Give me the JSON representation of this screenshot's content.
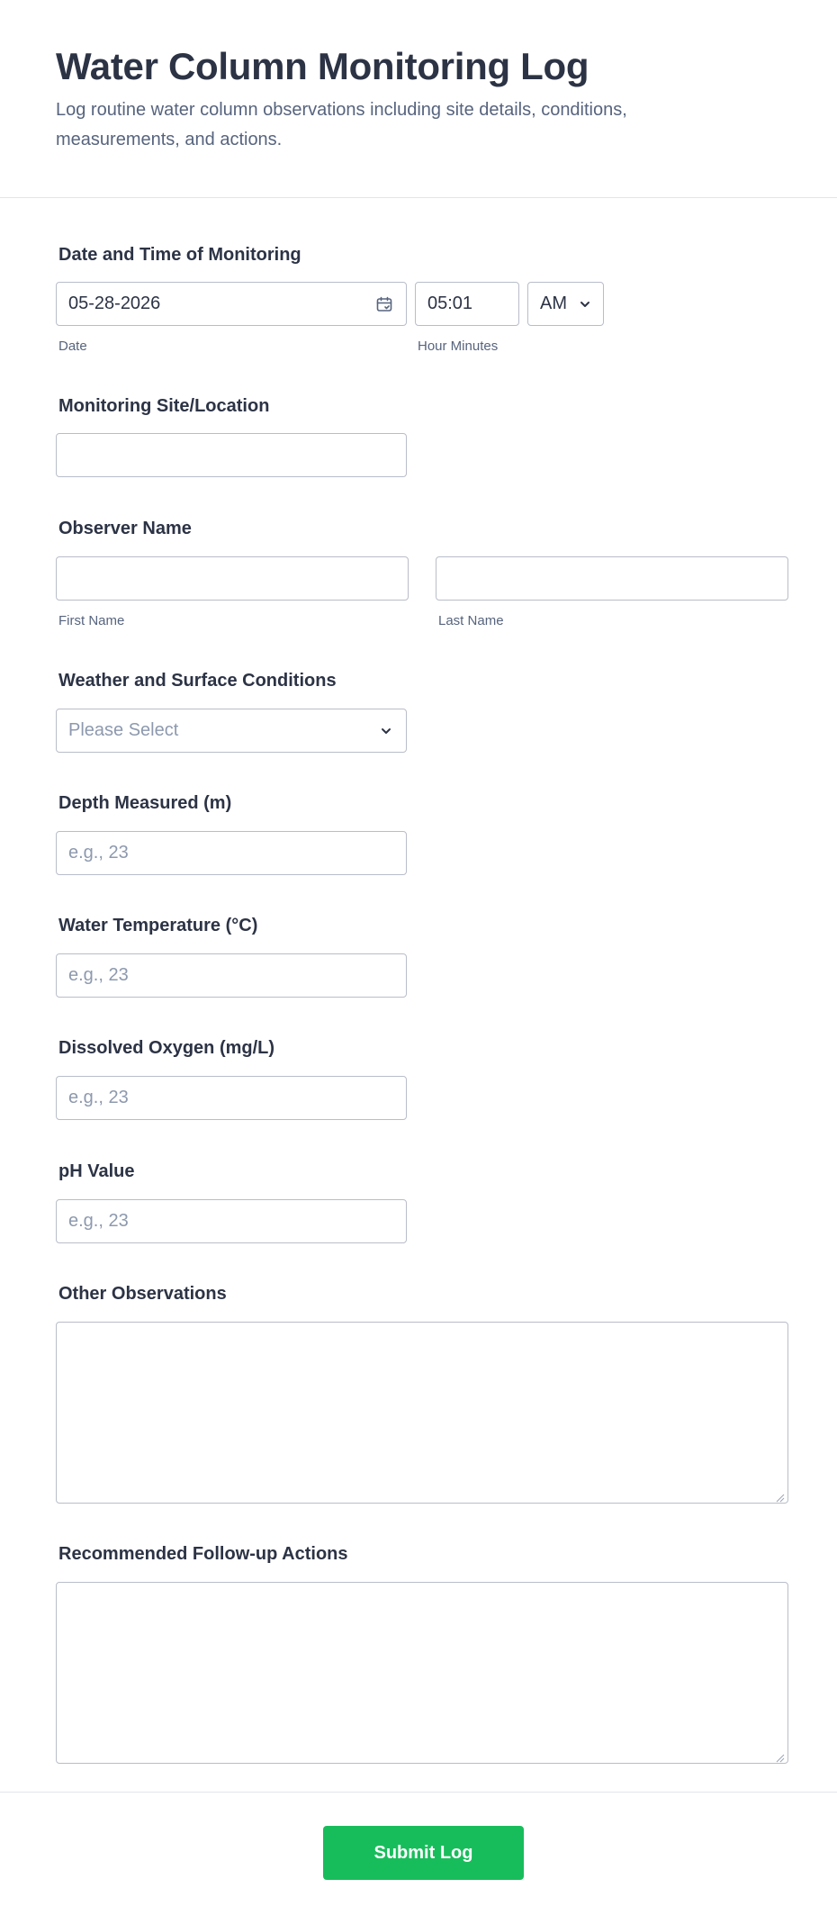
{
  "form": {
    "title": "Water Column Monitoring Log",
    "description": "Log routine water column observations including site details, conditions, measurements, and actions."
  },
  "datetime": {
    "label": "Date and Time of Monitoring",
    "date_value": "05-28-2026",
    "date_sublabel": "Date",
    "time_value": "05:01",
    "time_sublabel": "Hour Minutes",
    "ampm_value": "AM"
  },
  "site": {
    "label": "Monitoring Site/Location",
    "value": ""
  },
  "observer": {
    "label": "Observer Name",
    "first_value": "",
    "first_sublabel": "First Name",
    "last_value": "",
    "last_sublabel": "Last Name"
  },
  "weather": {
    "label": "Weather and Surface Conditions",
    "selected": "Please Select"
  },
  "depth": {
    "label": "Depth Measured (m)",
    "placeholder": "e.g., 23"
  },
  "temperature": {
    "label": "Water Temperature (°C)",
    "placeholder": "e.g., 23"
  },
  "oxygen": {
    "label": "Dissolved Oxygen (mg/L)",
    "placeholder": "e.g., 23"
  },
  "ph": {
    "label": "pH Value",
    "placeholder": "e.g., 23"
  },
  "observations": {
    "label": "Other Observations",
    "value": ""
  },
  "actions": {
    "label": "Recommended Follow-up Actions",
    "value": ""
  },
  "submit": {
    "label": "Submit Log",
    "color": "#18bd5b"
  },
  "icons": {
    "date": "calendar-icon",
    "select": "chevron-down-icon",
    "resize": "resize-grip-icon"
  }
}
